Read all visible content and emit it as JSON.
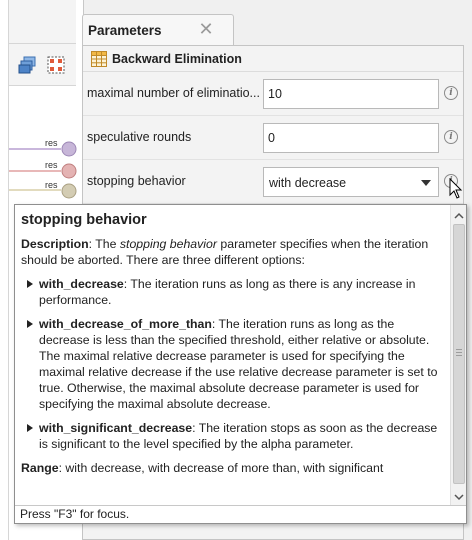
{
  "panel": {
    "tab_title": "Parameters",
    "close_symbol": "✕"
  },
  "operator": {
    "name": "Backward Elimination",
    "icon": "table-icon"
  },
  "parameters": [
    {
      "label": "maximal number of eliminatio...",
      "value": "10",
      "type": "text"
    },
    {
      "label": "speculative rounds",
      "value": "0",
      "type": "text"
    },
    {
      "label": "stopping behavior",
      "value": "with decrease",
      "type": "select"
    }
  ],
  "info_symbol": "i",
  "canvas": {
    "port_labels": [
      "res",
      "res",
      "res"
    ],
    "port_colors": [
      "#c7b6d8",
      "#e0a7a7",
      "#cfc8b0"
    ]
  },
  "tooltip": {
    "title": "stopping behavior",
    "description": {
      "label": "Description",
      "before": ": The ",
      "param": "stopping behavior",
      "after": " parameter specifies when the iteration should be aborted. There are three different options:"
    },
    "options": [
      {
        "name": "with_decrease",
        "text": ": The iteration runs as long as there is any increase in performance."
      },
      {
        "name": "with_decrease_of_more_than",
        "text": ": The iteration runs as long as the decrease is less than the specified threshold, either relative or absolute. The maximal relative decrease parameter is used for specifying the maximal relative decrease if the use relative decrease parameter is set to true. Otherwise, the maximal absolute decrease parameter is used for specifying the maximal absolute decrease."
      },
      {
        "name": "with_significant_decrease",
        "text": ": The iteration stops as soon as the decrease is significant to the level specified by the alpha parameter."
      }
    ],
    "range": {
      "label": "Range",
      "text": ": with decrease, with decrease of more than, with significant"
    },
    "footer": "Press \"F3\" for focus."
  }
}
